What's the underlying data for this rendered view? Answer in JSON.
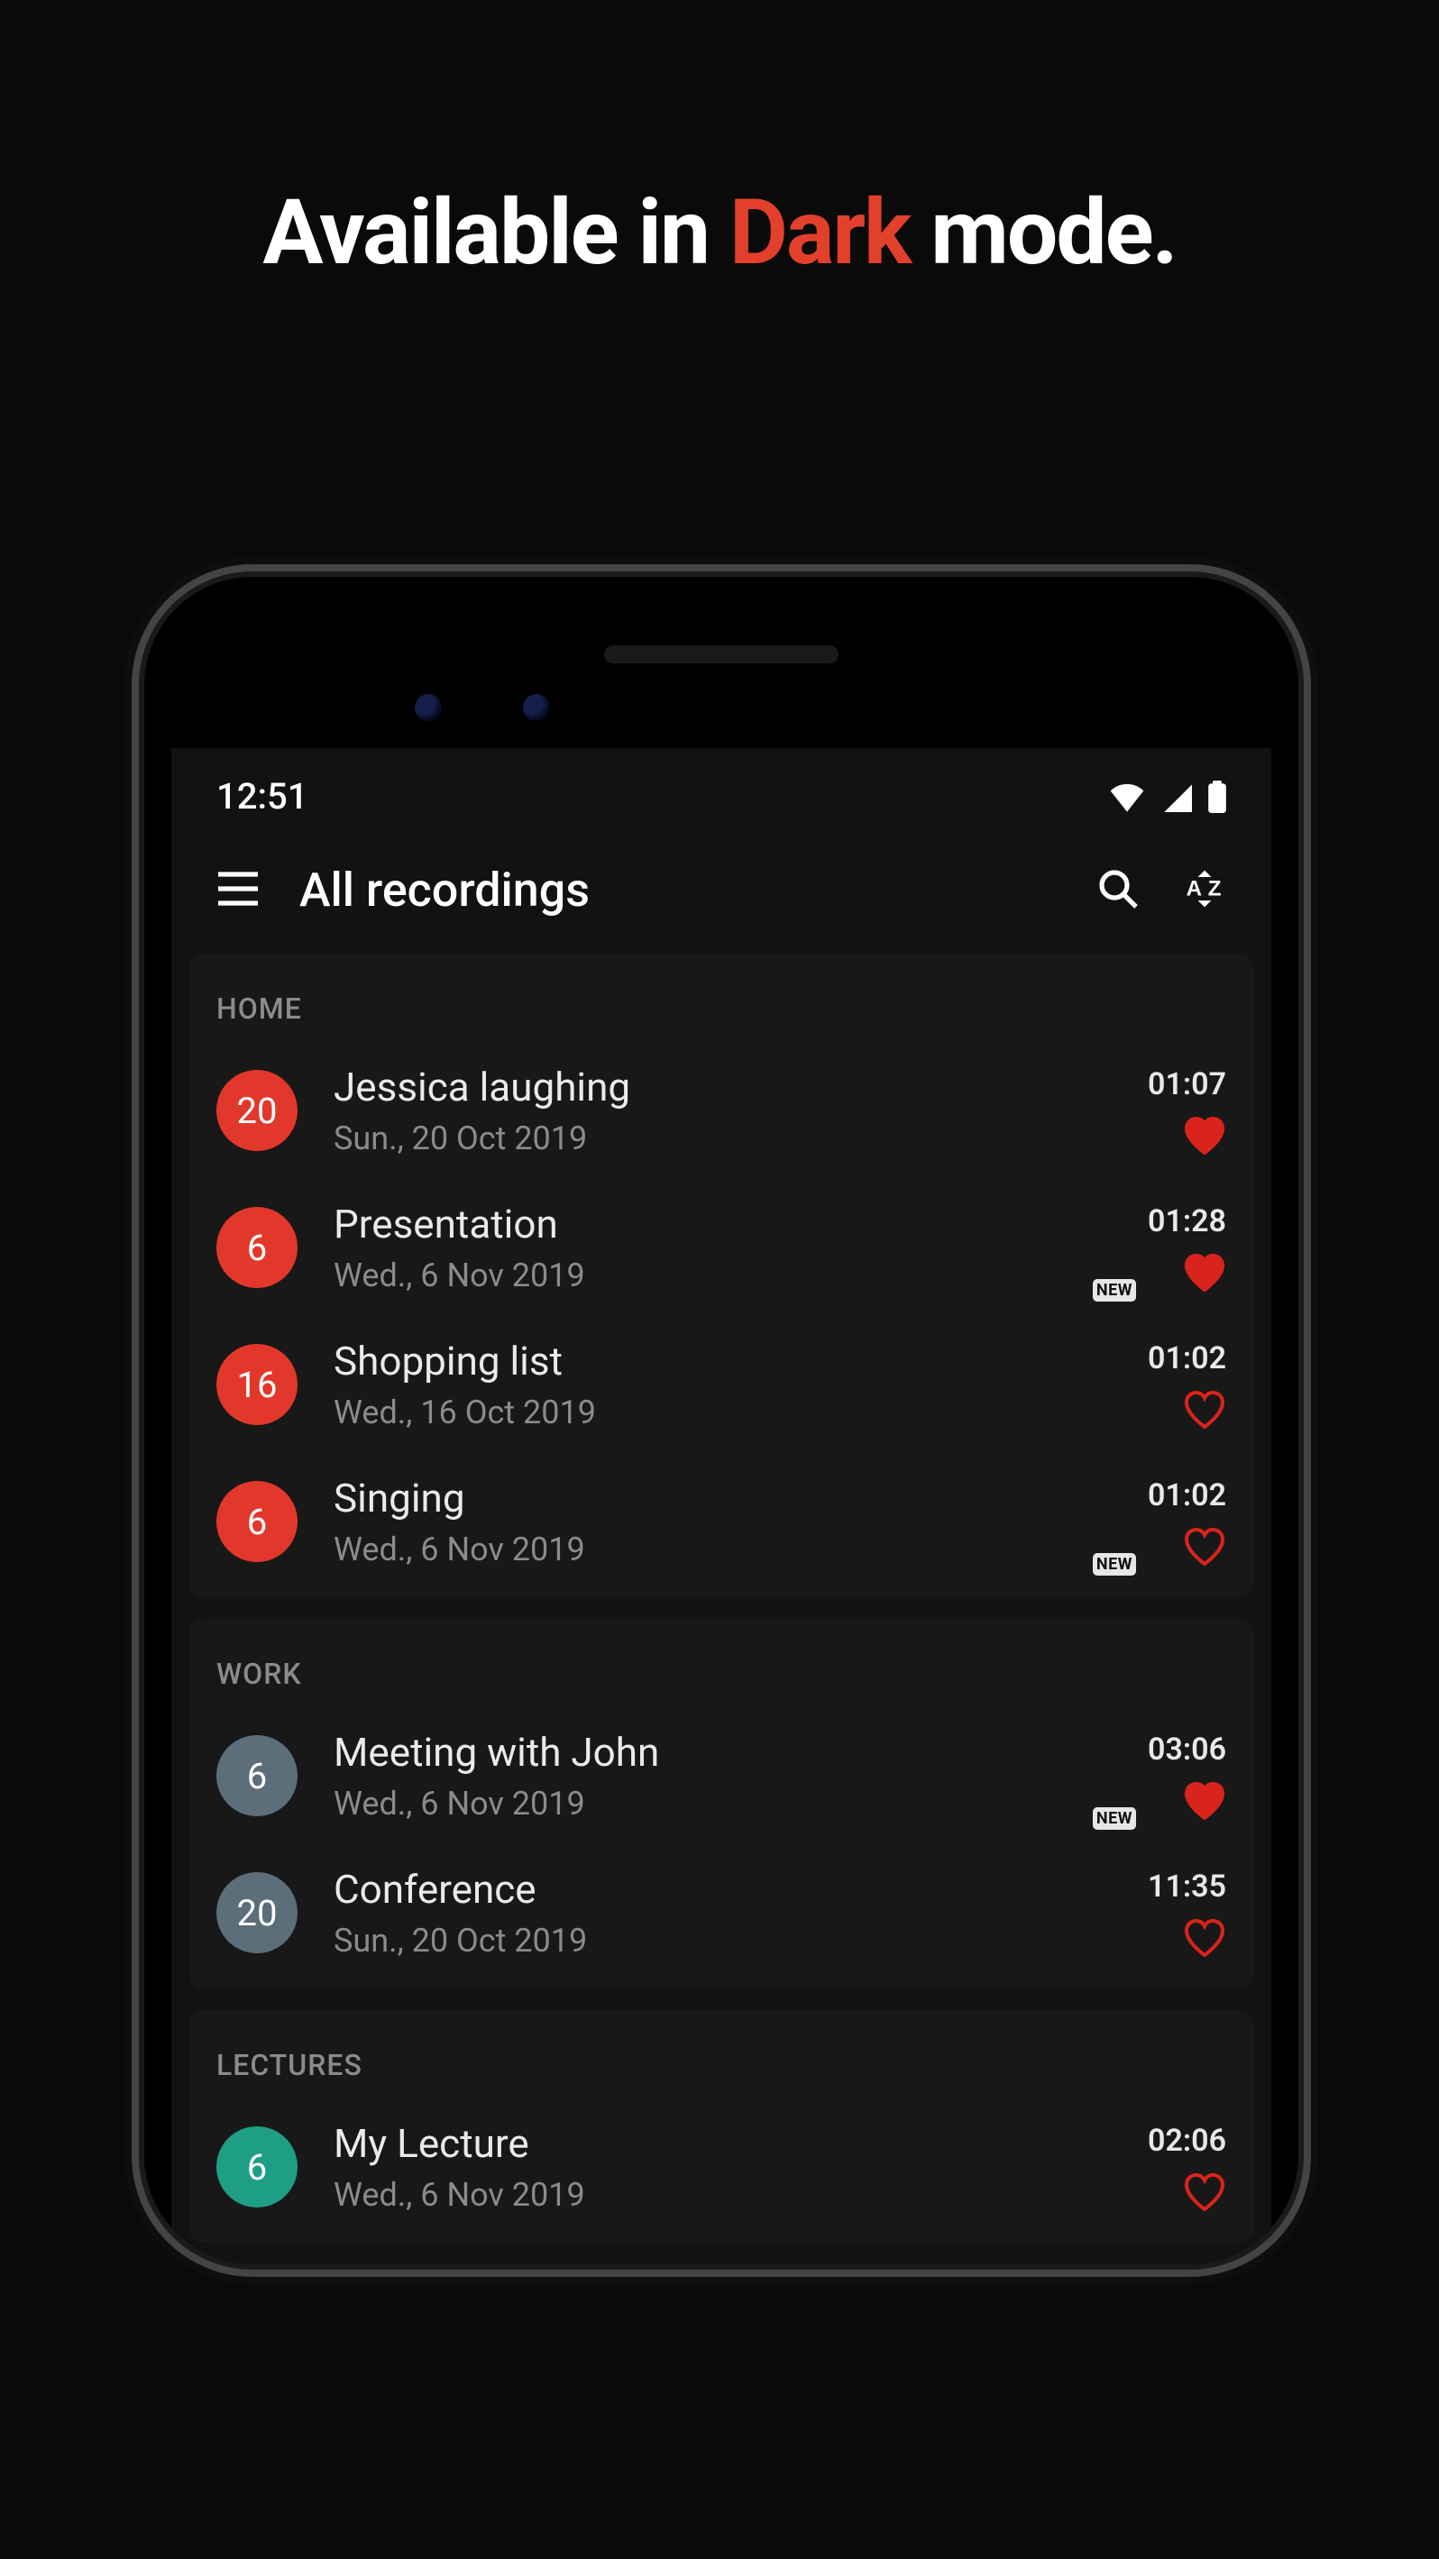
{
  "hero": {
    "a": "Available in ",
    "b": "Dark",
    "c": " mode."
  },
  "statusbar": {
    "time": "12:51"
  },
  "appbar": {
    "title": "All recordings"
  },
  "new_badge_label": "NEW",
  "sections": [
    {
      "label": "HOME",
      "bubble_class": "bubble-red",
      "items": [
        {
          "day": "20",
          "name": "Jessica laughing",
          "date": "Sun., 20 Oct 2019",
          "duration": "01:07",
          "fav": true,
          "isnew": false
        },
        {
          "day": "6",
          "name": "Presentation",
          "date": "Wed., 6 Nov 2019",
          "duration": "01:28",
          "fav": true,
          "isnew": true
        },
        {
          "day": "16",
          "name": "Shopping list",
          "date": "Wed., 16 Oct 2019",
          "duration": "01:02",
          "fav": false,
          "isnew": false
        },
        {
          "day": "6",
          "name": "Singing",
          "date": "Wed., 6 Nov 2019",
          "duration": "01:02",
          "fav": false,
          "isnew": true
        }
      ]
    },
    {
      "label": "WORK",
      "bubble_class": "bubble-blue",
      "items": [
        {
          "day": "6",
          "name": "Meeting with John",
          "date": "Wed., 6 Nov 2019",
          "duration": "03:06",
          "fav": true,
          "isnew": true
        },
        {
          "day": "20",
          "name": "Conference",
          "date": "Sun., 20 Oct 2019",
          "duration": "11:35",
          "fav": false,
          "isnew": false
        }
      ]
    },
    {
      "label": "LECTURES",
      "bubble_class": "bubble-teal",
      "items": [
        {
          "day": "6",
          "name": "My Lecture",
          "date": "Wed., 6 Nov 2019",
          "duration": "02:06",
          "fav": false,
          "isnew": false
        }
      ]
    }
  ]
}
